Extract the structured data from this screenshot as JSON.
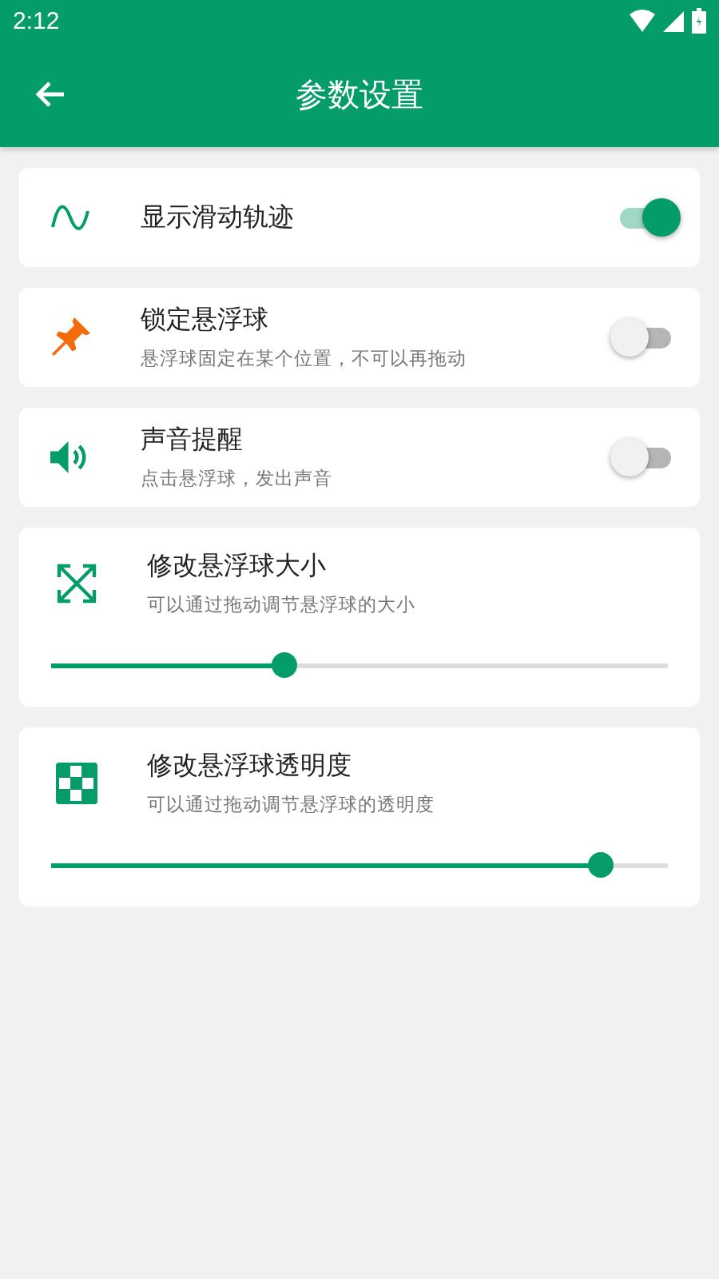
{
  "status_bar": {
    "time": "2:12"
  },
  "app_bar": {
    "title": "参数设置"
  },
  "settings": [
    {
      "kind": "toggle",
      "title": "显示滑动轨迹",
      "on": true
    },
    {
      "kind": "toggle",
      "title": "锁定悬浮球",
      "subtitle": "悬浮球固定在某个位置，不可以再拖动",
      "on": false
    },
    {
      "kind": "toggle",
      "title": "声音提醒",
      "subtitle": "点击悬浮球，发出声音",
      "on": false
    },
    {
      "kind": "slider",
      "title": "修改悬浮球大小",
      "subtitle": "可以通过拖动调节悬浮球的大小",
      "level": 0.377
    },
    {
      "kind": "slider",
      "title": "修改悬浮球透明度",
      "subtitle": "可以通过拖动调节悬浮球的透明度",
      "level": 0.89
    }
  ]
}
